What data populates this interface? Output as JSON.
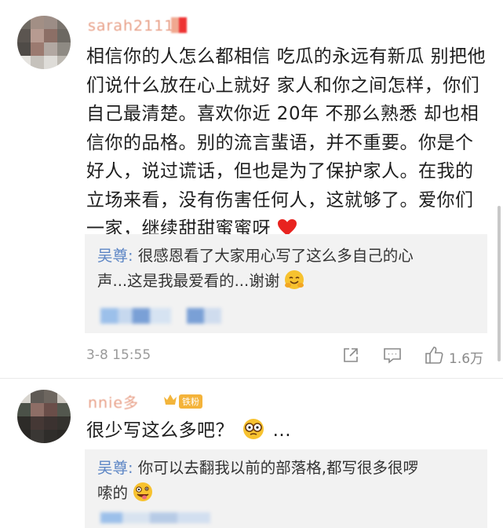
{
  "comments": [
    {
      "username": "sarah21111",
      "text": "相信你的人怎么都相信 吃瓜的永远有新瓜 别把他们说什么放在心上就好 家人和你之间怎样，你们自己最清楚。喜欢你近 20年 不那么熟悉 却也相信你的品格。别的流言蜚语，并不重要。你是个好人，说过谎话，但也是为了保护家人。在我的立场来看，没有伤害任何人，这就够了。爱你们一家，继续甜甜蜜蜜呀",
      "lines": [
        "相信你的人怎么都相信 吃瓜的永远有新瓜 别把他",
        "们说什么放在心上就好 家人和你之间怎样，你们",
        "自己最清楚。喜欢你近 20年 不那么熟悉 却也相",
        "信你的品格。别的流言蜚语，并不重要。你是个",
        "好人，说过谎话，但也是为了保护家人。在我的",
        "立场来看，没有伤害任何人，这就够了。爱你们",
        "一家，继续甜甜蜜蜜呀"
      ],
      "emoji": "heart-emoji",
      "reply": {
        "author": "吴尊",
        "separator": ":",
        "line1": "很感恩看了大家用心写了这么多自己的心",
        "line2": "声...这是我最爱看的...谢谢",
        "emoji": "hug-emoji"
      },
      "time": "3-8 15:55",
      "likes": "1.6万"
    },
    {
      "username": "nnie多",
      "badge": "铁粉",
      "text": "很少写这么多吧？",
      "emoji": "glasses-emoji",
      "trail": "...",
      "reply": {
        "author": "吴尊",
        "separator": ":",
        "line1": "你可以去翻我以前的部落格,都写很多很啰",
        "line2": "嗦的",
        "emoji": "crazy-face-emoji"
      }
    }
  ],
  "colors": {
    "username": "#e8a088",
    "reply_name": "#5d86c5",
    "reply_bg": "#f2f2f2",
    "meta": "#9a9a9a",
    "heart": "#e8231f"
  },
  "icons": [
    "share-icon",
    "comment-icon",
    "like-icon",
    "vip-crown-icon"
  ]
}
